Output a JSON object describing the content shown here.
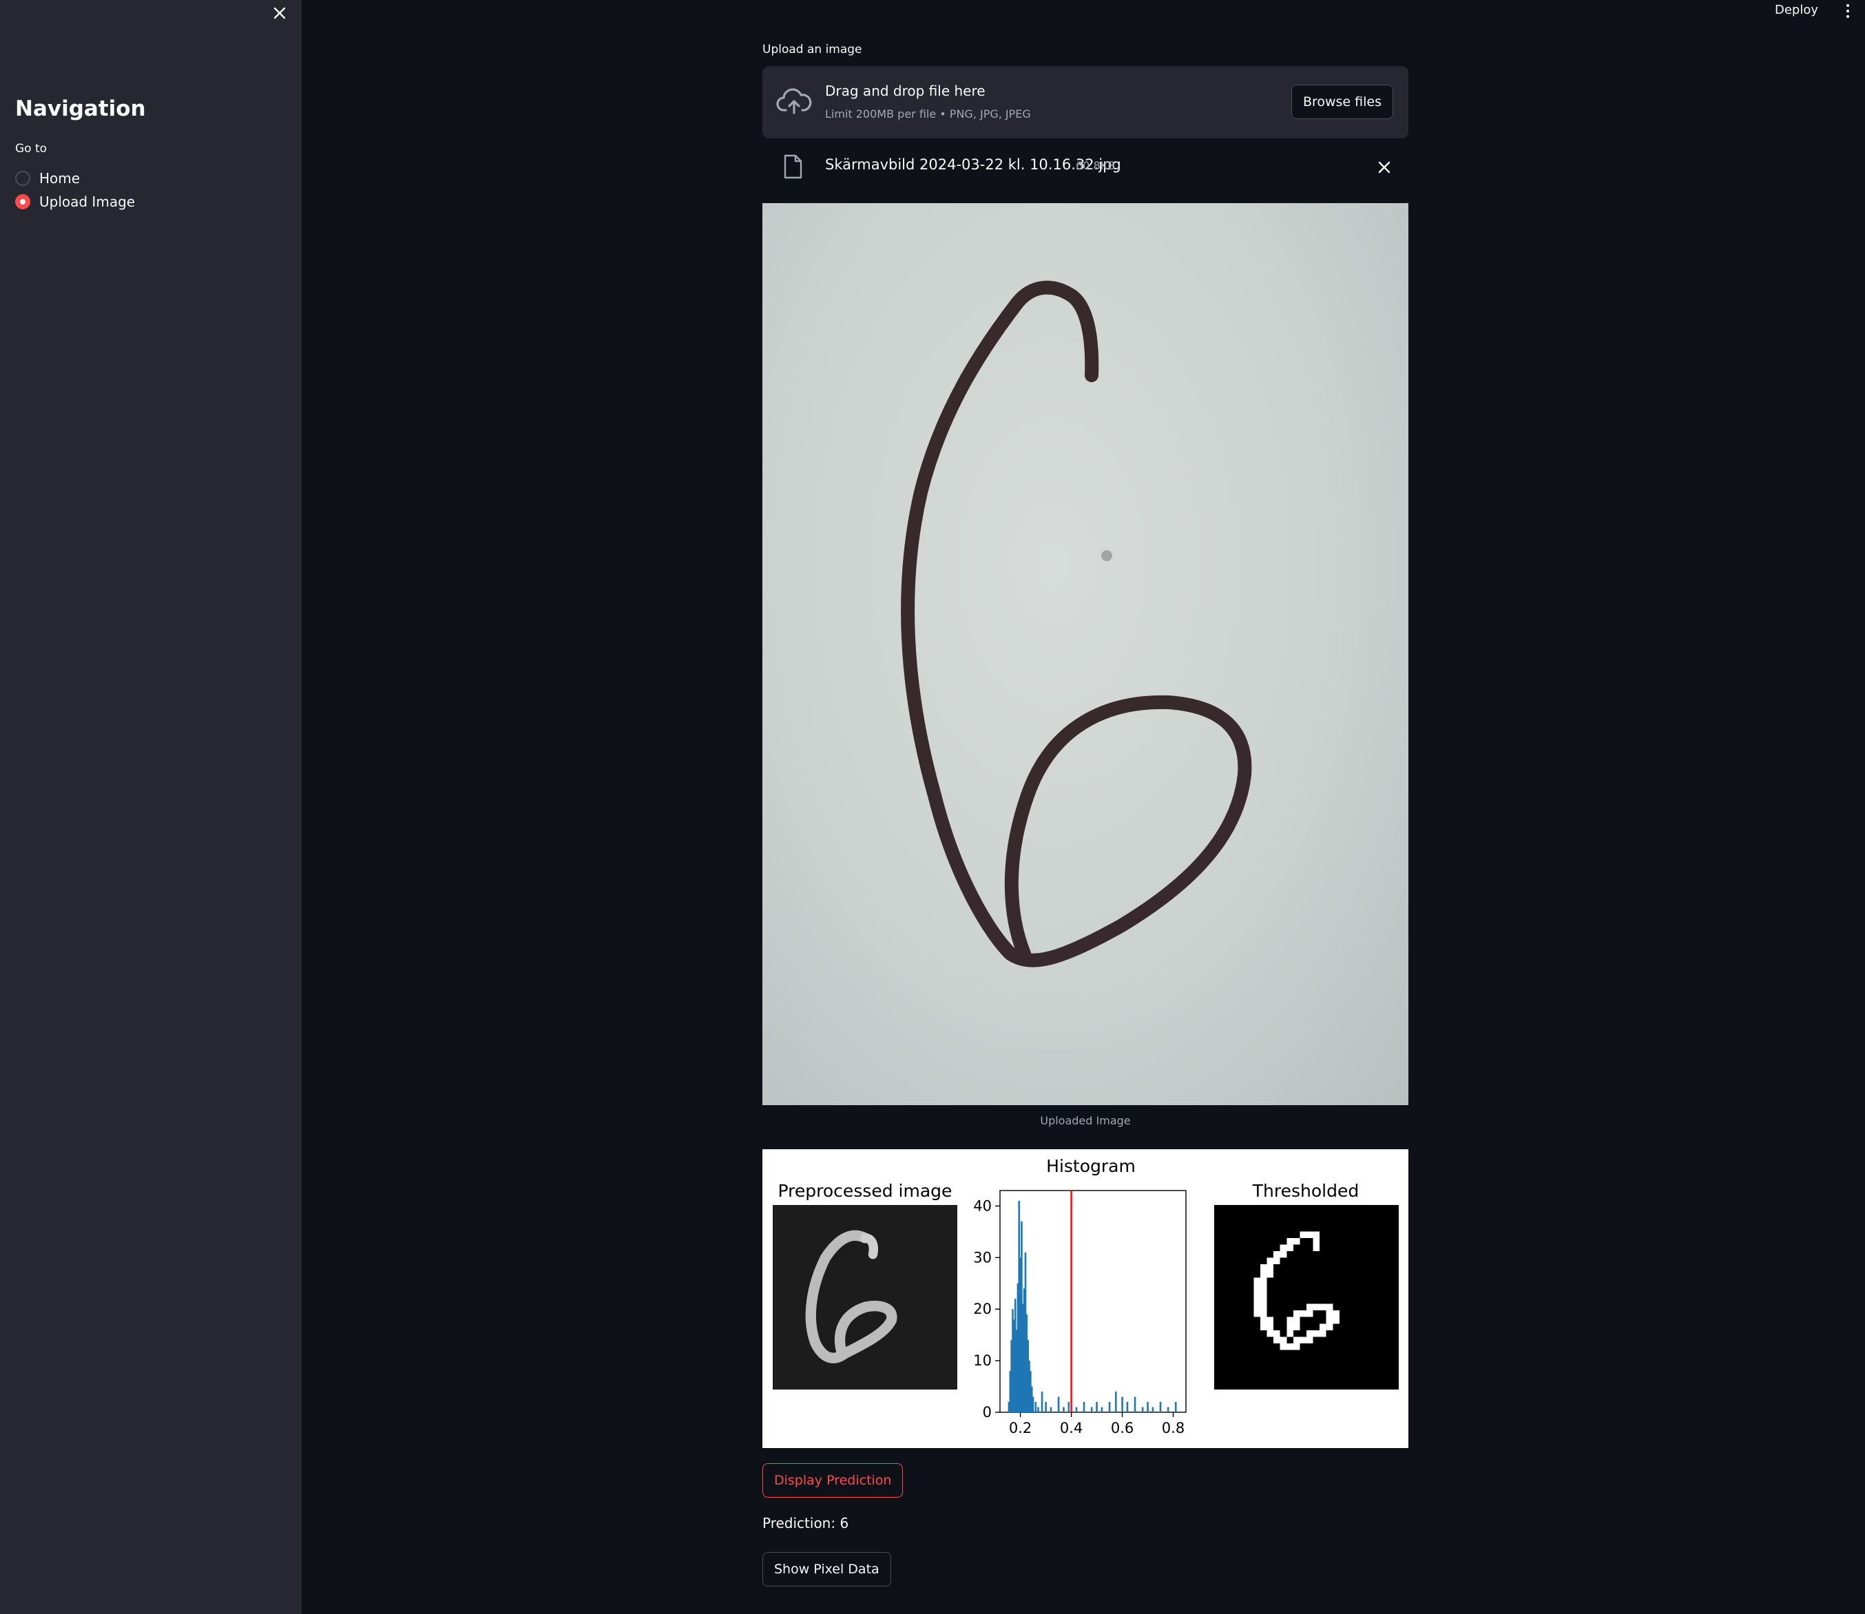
{
  "sidebar": {
    "title": "Navigation",
    "radio_label": "Go to",
    "options": [
      {
        "label": "Home",
        "checked": false
      },
      {
        "label": "Upload Image",
        "checked": true
      }
    ]
  },
  "header": {
    "deploy_label": "Deploy"
  },
  "uploader": {
    "label": "Upload an image",
    "drop_title": "Drag and drop file here",
    "drop_subtitle": "Limit 200MB per file • PNG, JPG, JPEG",
    "browse_label": "Browse files"
  },
  "file": {
    "name": "Skärmavbild 2024-03-22 kl. 10.16.32.jpg",
    "size": "60.8KB"
  },
  "image": {
    "caption": "Uploaded Image"
  },
  "plots": {
    "preprocessed_title": "Preprocessed image",
    "thresholded_title": "Thresholded"
  },
  "chart_data": {
    "type": "bar",
    "title": "Histogram",
    "xlabel": "",
    "ylabel": "",
    "xlim": [
      0.12,
      0.85
    ],
    "ylim": [
      0,
      43
    ],
    "xticks": [
      "0.2",
      "0.4",
      "0.6",
      "0.8"
    ],
    "xtick_values": [
      0.2,
      0.4,
      0.6,
      0.8
    ],
    "yticks": [
      "0",
      "10",
      "20",
      "30",
      "40"
    ],
    "ytick_values": [
      0,
      10,
      20,
      30,
      40
    ],
    "threshold": 0.4,
    "threshold_color": "#ff0000",
    "bar_color": "#1f77b4",
    "bins": [
      {
        "x": 0.155,
        "y": 2
      },
      {
        "x": 0.16,
        "y": 8
      },
      {
        "x": 0.165,
        "y": 14
      },
      {
        "x": 0.17,
        "y": 20
      },
      {
        "x": 0.175,
        "y": 18
      },
      {
        "x": 0.18,
        "y": 22
      },
      {
        "x": 0.185,
        "y": 16
      },
      {
        "x": 0.19,
        "y": 25
      },
      {
        "x": 0.195,
        "y": 41
      },
      {
        "x": 0.2,
        "y": 30
      },
      {
        "x": 0.205,
        "y": 37
      },
      {
        "x": 0.21,
        "y": 21
      },
      {
        "x": 0.215,
        "y": 24
      },
      {
        "x": 0.22,
        "y": 31
      },
      {
        "x": 0.225,
        "y": 19
      },
      {
        "x": 0.23,
        "y": 14
      },
      {
        "x": 0.235,
        "y": 10
      },
      {
        "x": 0.24,
        "y": 8
      },
      {
        "x": 0.245,
        "y": 5
      },
      {
        "x": 0.25,
        "y": 3
      },
      {
        "x": 0.26,
        "y": 2
      },
      {
        "x": 0.27,
        "y": 1
      },
      {
        "x": 0.285,
        "y": 4
      },
      {
        "x": 0.3,
        "y": 2
      },
      {
        "x": 0.32,
        "y": 1
      },
      {
        "x": 0.35,
        "y": 3
      },
      {
        "x": 0.37,
        "y": 1
      },
      {
        "x": 0.39,
        "y": 2
      },
      {
        "x": 0.42,
        "y": 1
      },
      {
        "x": 0.45,
        "y": 2
      },
      {
        "x": 0.48,
        "y": 1
      },
      {
        "x": 0.5,
        "y": 2
      },
      {
        "x": 0.52,
        "y": 1
      },
      {
        "x": 0.55,
        "y": 2
      },
      {
        "x": 0.575,
        "y": 4
      },
      {
        "x": 0.6,
        "y": 3
      },
      {
        "x": 0.62,
        "y": 2
      },
      {
        "x": 0.65,
        "y": 3
      },
      {
        "x": 0.68,
        "y": 1
      },
      {
        "x": 0.7,
        "y": 2
      },
      {
        "x": 0.72,
        "y": 1
      },
      {
        "x": 0.75,
        "y": 2
      },
      {
        "x": 0.78,
        "y": 1
      },
      {
        "x": 0.81,
        "y": 2
      }
    ]
  },
  "actions": {
    "predict_label": "Display Prediction",
    "prediction_text": "Prediction: 6",
    "pixel_label": "Show Pixel Data"
  },
  "colors": {
    "accent": "#ff4b4b",
    "sidebar_bg": "#262730",
    "app_bg": "#0e1117"
  }
}
